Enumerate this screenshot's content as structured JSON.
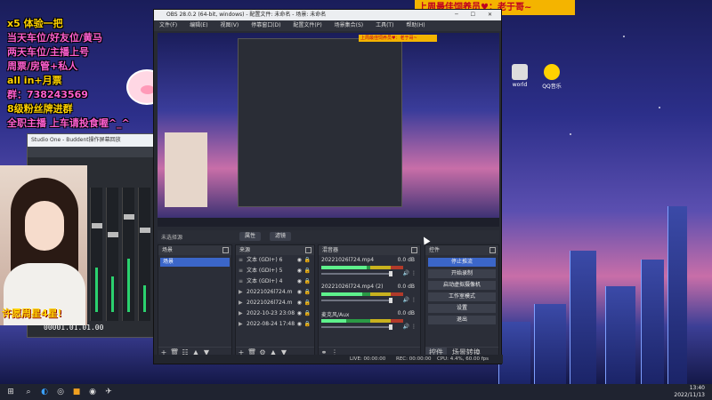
{
  "banner": {
    "text": "上周最佳饲养员♥：老于哥~"
  },
  "overlay": {
    "lines": [
      "x5 体验一把",
      "当天车位/好友位/黄马",
      "两天车位/主播上号",
      "周票/房管+私人",
      "all in+月票",
      "群：738243569",
      "8级粉丝牌进群",
      "全职主播 上车请投食喔^_^"
    ],
    "wish": "许愿周星4星!"
  },
  "desktop_icons": [
    {
      "label": "world",
      "color": "#dddddd"
    },
    {
      "label": "QQ音乐",
      "color": "#ffd200"
    }
  ],
  "studio": {
    "title": "Studio One - Buddent操作屏幕回放",
    "time": "00001.01.01.00"
  },
  "obs": {
    "title": "OBS 28.0.2 (64-bit, windows) - 配置文件: 未命名 - 场景: 未命名",
    "menu": [
      "文件(F)",
      "编辑(E)",
      "视图(V)",
      "停靠窗口(D)",
      "配置文件(P)",
      "场景集合(S)",
      "工具(T)",
      "帮助(H)"
    ],
    "preview_banner": "上周最佳饲养员♥：老于哥~",
    "no_source": "未选择源",
    "tab_props": "属性",
    "tab_filters": "滤镜",
    "scenes": {
      "title": "场景",
      "items": [
        "场景"
      ]
    },
    "sources": {
      "title": "来源",
      "items": [
        "文本 (GDI+) 6",
        "文本 (GDI+) 5",
        "文本 (GDI+) 4",
        "20221026l724.m",
        "20221026l724.m",
        "2022-10-23 23:08",
        "2022-08-24 17:48"
      ]
    },
    "mixer": {
      "title": "混音器",
      "items": [
        {
          "name": "20221026l724.mp4",
          "db": "0.0 dB",
          "level": 0.55
        },
        {
          "name": "20221026l724.mp4 (2)",
          "db": "0.0 dB",
          "level": 0.5
        },
        {
          "name": "麦克风/Aux",
          "db": "0.0 dB",
          "level": 0.3
        }
      ]
    },
    "controls": {
      "title": "控件",
      "buttons": [
        {
          "label": "停止推流",
          "active": true
        },
        {
          "label": "开始录制",
          "active": false
        },
        {
          "label": "启动虚拟摄像机",
          "active": false
        },
        {
          "label": "工作室模式",
          "active": false
        },
        {
          "label": "设置",
          "active": false
        },
        {
          "label": "退出",
          "active": false
        }
      ],
      "tabs": [
        "控件",
        "场景转换"
      ]
    },
    "status": {
      "live": "LIVE: 00:00:00",
      "rec": "REC: 00:00:00",
      "cpu": "CPU: 4.4%, 60.00 fps"
    }
  },
  "taskbar": {
    "time": "13:40",
    "date": "2022/11/13"
  }
}
